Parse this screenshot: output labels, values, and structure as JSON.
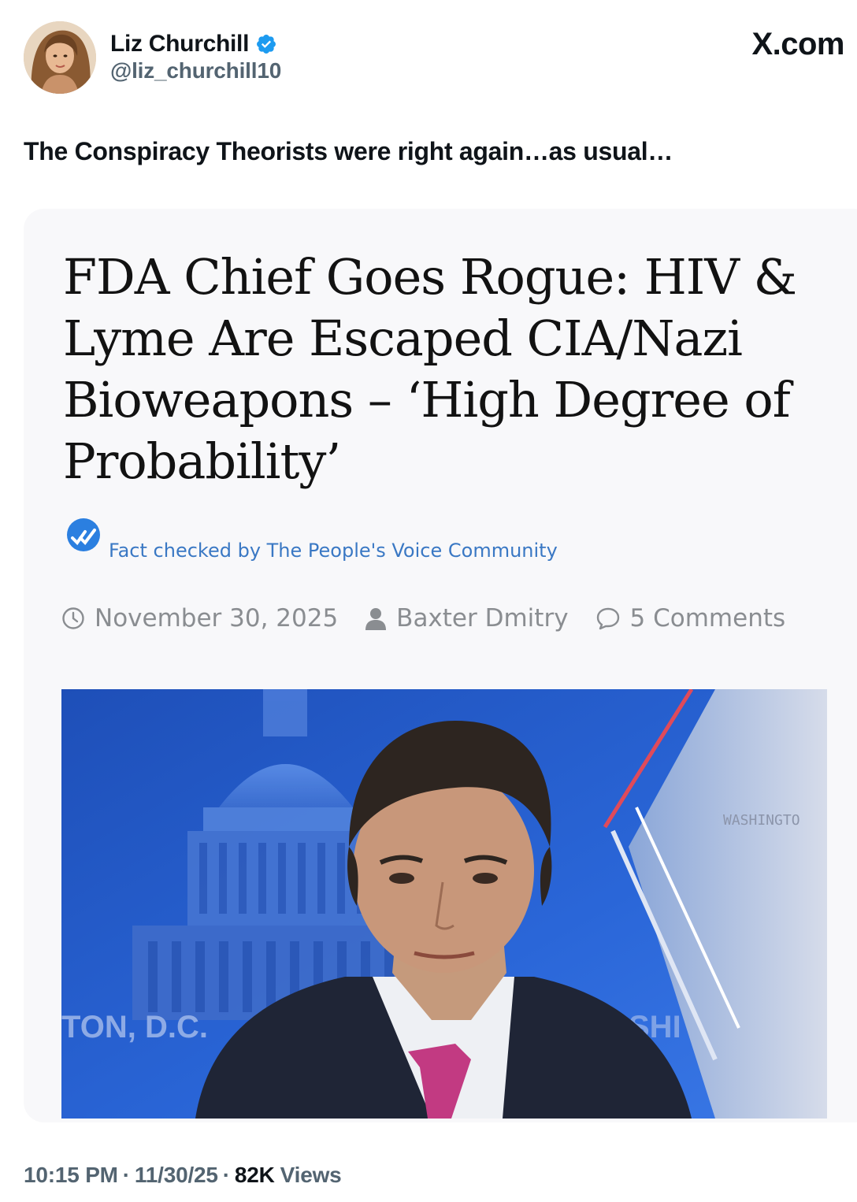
{
  "header": {
    "display_name": "Liz Churchill",
    "handle": "@liz_churchill10",
    "site_logo": "X.com",
    "verified_icon": "verified-badge-icon",
    "accent_color": "#1d9bf0"
  },
  "tweet": {
    "text": "The Conspiracy Theorists were right again…as usual…"
  },
  "article": {
    "headline": "FDA Chief Goes Rogue: HIV & Lyme Are Escaped CIA/Nazi Bioweapons – ‘High Degree of Probability’",
    "fact_check_label": "Fact checked by The People's Voice Community",
    "date": "November 30, 2025",
    "author": "Baxter Dmitry",
    "comments": "5 Comments",
    "image": {
      "lower_third_left": "TON, D.C.",
      "lower_third_right": "SHI",
      "wall_text": "WASHINGTO"
    }
  },
  "footer": {
    "time": "10:15 PM",
    "date": "11/30/25",
    "views_count": "82K",
    "views_label": "Views"
  }
}
